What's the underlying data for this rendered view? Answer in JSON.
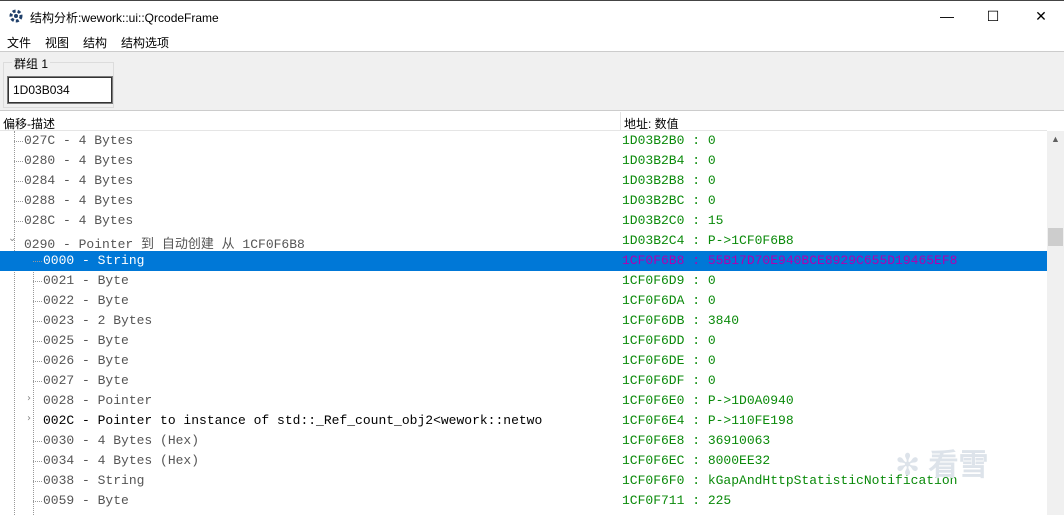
{
  "window": {
    "title": "结构分析:wework::ui::QrcodeFrame",
    "minimize": "—",
    "maximize": "☐",
    "close": "✕"
  },
  "menu": [
    "文件",
    "视图",
    "结构",
    "结构选项"
  ],
  "group": {
    "label": "群组 1",
    "address": "1D03B034"
  },
  "columns": {
    "desc": "偏移-描述",
    "value": "地址: 数值"
  },
  "rows": [
    {
      "level": 0,
      "desc": "027C - 4 Bytes",
      "value": "1D03B2B0 : 0"
    },
    {
      "level": 0,
      "desc": "0280 - 4 Bytes",
      "value": "1D03B2B4 : 0"
    },
    {
      "level": 0,
      "desc": "0284 - 4 Bytes",
      "value": "1D03B2B8 : 0"
    },
    {
      "level": 0,
      "desc": "0288 - 4 Bytes",
      "value": "1D03B2BC : 0"
    },
    {
      "level": 0,
      "desc": "028C - 4 Bytes",
      "value": "1D03B2C0 : 15"
    },
    {
      "level": 0,
      "desc": "0290 - Pointer 到 自动创建 从 1CF0F6B8",
      "value": "1D03B2C4 : P->1CF0F6B8",
      "expanded": true
    },
    {
      "level": 1,
      "desc": "0000 - String",
      "value": "1CF0F6B8 : 55B17D70E940BCE8929C655D19465EF8",
      "selected": true
    },
    {
      "level": 1,
      "desc": "0021 - Byte",
      "value": "1CF0F6D9 : 0"
    },
    {
      "level": 1,
      "desc": "0022 - Byte",
      "value": "1CF0F6DA : 0"
    },
    {
      "level": 1,
      "desc": "0023 - 2 Bytes",
      "value": "1CF0F6DB : 3840"
    },
    {
      "level": 1,
      "desc": "0025 - Byte",
      "value": "1CF0F6DD : 0"
    },
    {
      "level": 1,
      "desc": "0026 - Byte",
      "value": "1CF0F6DE : 0"
    },
    {
      "level": 1,
      "desc": "0027 - Byte",
      "value": "1CF0F6DF : 0"
    },
    {
      "level": 1,
      "desc": "0028 - Pointer",
      "value": "1CF0F6E0 : P->1D0A0940",
      "collapsed": true
    },
    {
      "level": 1,
      "desc": "002C - Pointer to instance of std::_Ref_count_obj2<wework::netwo",
      "value": "1CF0F6E4 : P->110FE198",
      "collapsed": true,
      "bold": true
    },
    {
      "level": 1,
      "desc": "0030 - 4 Bytes (Hex)",
      "value": "1CF0F6E8 : 36910063"
    },
    {
      "level": 1,
      "desc": "0034 - 4 Bytes (Hex)",
      "value": "1CF0F6EC : 8000EE32"
    },
    {
      "level": 1,
      "desc": "0038 - String",
      "value": "1CF0F6F0 : kGapAndHttpStatisticNotification"
    },
    {
      "level": 1,
      "desc": "0059 - Byte",
      "value": "1CF0F711 : 225"
    }
  ],
  "watermark": "看雪"
}
